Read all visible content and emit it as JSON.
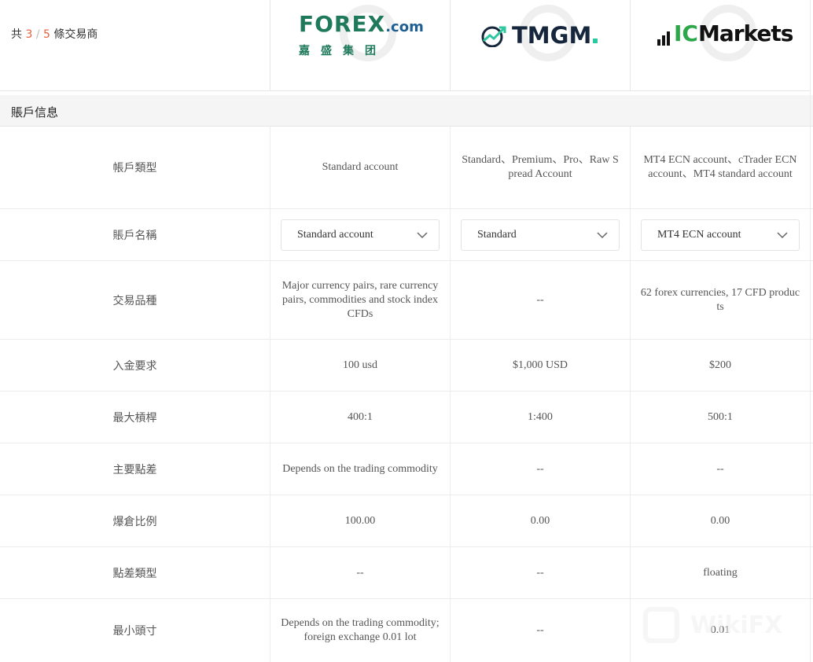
{
  "header": {
    "count_prefix": "共",
    "count_current": "3",
    "count_sep": "/",
    "count_total": "5",
    "count_suffix": "條交易商"
  },
  "brokers": [
    {
      "logo_main": "FOREX",
      "logo_com": ".com",
      "logo_sub": "嘉盛集团"
    },
    {
      "logo_word": "TMGM"
    },
    {
      "logo_ic": "IC",
      "logo_markets": "Markets"
    }
  ],
  "section": {
    "label": "賬戶信息"
  },
  "rows": [
    {
      "label": "帳戶類型",
      "values": [
        "Standard account",
        "Standard、Premium、Pro、Raw Spread Account",
        "MT4 ECN account、cTrader ECN account、MT4 standard account"
      ]
    },
    {
      "label": "賬戶名稱",
      "selects": [
        "Standard account",
        "Standard",
        "MT4 ECN account"
      ]
    },
    {
      "label": "交易品種",
      "values": [
        "Major currency pairs, rare currency pairs, commodities and stock index CFDs",
        "--",
        "62 forex currencies, 17 CFD products"
      ]
    },
    {
      "label": "入金要求",
      "values": [
        "100 usd",
        "$1,000 USD",
        "$200"
      ]
    },
    {
      "label": "最大槓桿",
      "values": [
        "400:1",
        "1:400",
        "500:1"
      ]
    },
    {
      "label": "主要點差",
      "values": [
        "Depends on the trading commodity",
        "--",
        "--"
      ]
    },
    {
      "label": "爆倉比例",
      "values": [
        "100.00",
        "0.00",
        "0.00"
      ]
    },
    {
      "label": "點差類型",
      "values": [
        "--",
        "--",
        "floating"
      ]
    },
    {
      "label": "最小頭寸",
      "values": [
        "Depends on the trading commodity; foreign exchange 0.01 lot",
        "--",
        "0.01"
      ]
    }
  ],
  "watermark": {
    "text": "WikiFX"
  },
  "colors": {
    "accent": "#e8603c",
    "forex_green": "#1f7a5c",
    "ic_green": "#2ca84a",
    "tmgm_teal": "#2ec8a0"
  },
  "icons": {
    "dropdown": "chevron-down-icon"
  }
}
